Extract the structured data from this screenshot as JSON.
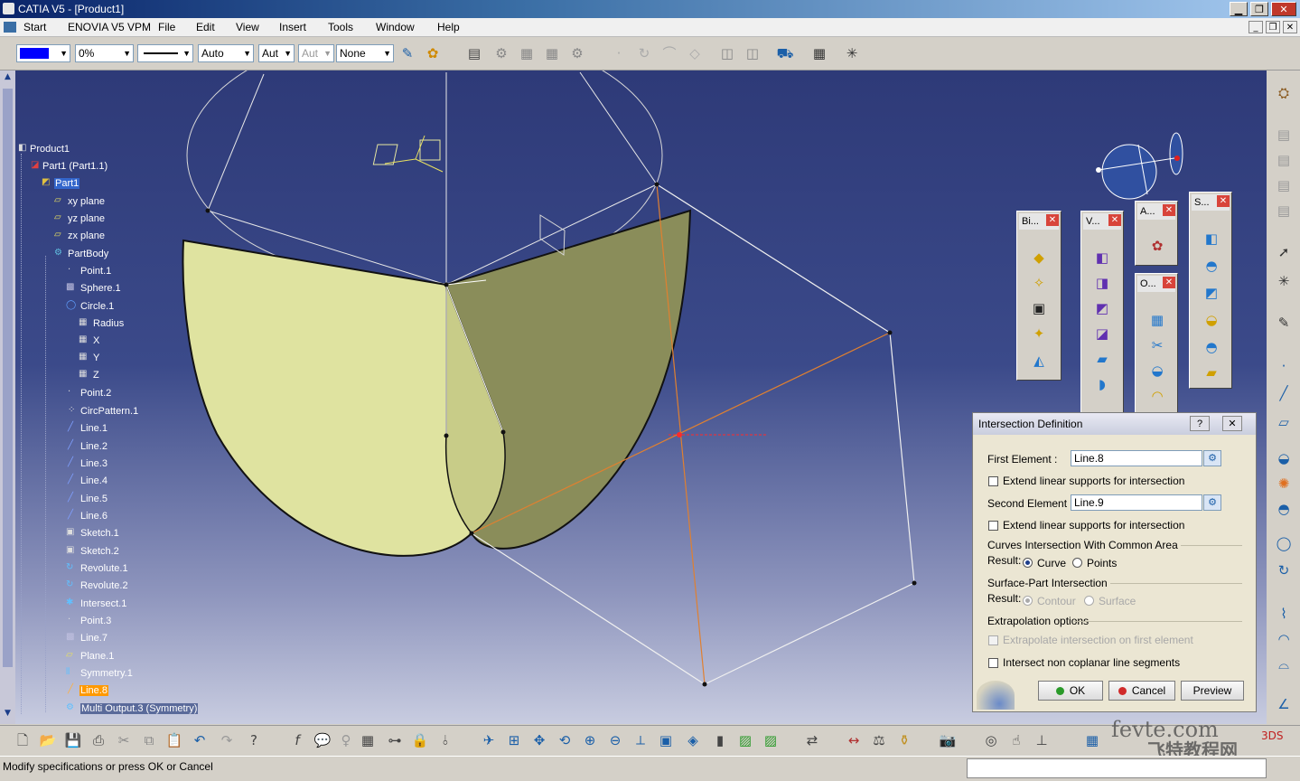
{
  "window": {
    "title": "CATIA V5 - [Product1]"
  },
  "menu": {
    "items": [
      "Start",
      "ENOVIA V5 VPM",
      "File",
      "Edit",
      "View",
      "Insert",
      "Tools",
      "Window",
      "Help"
    ]
  },
  "toolbar": {
    "color_hex": "#0000ff",
    "transparency": "0%",
    "linetype": "",
    "thickness": "Auto",
    "point_type": "Aut",
    "layer": "Aut",
    "render_style": "None"
  },
  "tree": {
    "nodes": [
      "Product1",
      "Part1 (Part1.1)",
      "Part1",
      "xy plane",
      "yz plane",
      "zx plane",
      "PartBody",
      "Point.1",
      "Sphere.1",
      "Circle.1",
      "Radius",
      "X",
      "Y",
      "Z",
      "Point.2",
      "CircPattern.1",
      "Line.1",
      "Line.2",
      "Line.3",
      "Line.4",
      "Line.5",
      "Line.6",
      "Sketch.1",
      "Sketch.2",
      "Revolute.1",
      "Revolute.2",
      "Intersect.1",
      "Point.3",
      "Line.7",
      "Plane.1",
      "Symmetry.1",
      "Line.8",
      "Multi Output.3 (Symmetry)"
    ]
  },
  "palettes": {
    "p1": "Bi...",
    "p2": "V...",
    "p3": "A...",
    "p4": "O...",
    "p5": "S..."
  },
  "dialog": {
    "title": "Intersection Definition",
    "help": "?",
    "first_label": "First Element :",
    "first_value": "Line.8",
    "extend1": "Extend linear supports for intersection",
    "second_label": "Second Element :",
    "second_value": "Line.9",
    "extend2": "Extend linear supports for intersection",
    "group1": "Curves Intersection With Common Area",
    "result1_label": "Result:",
    "curve": "Curve",
    "points": "Points",
    "group2": "Surface-Part Intersection",
    "result2_label": "Result:",
    "contour": "Contour",
    "surface": "Surface",
    "group3": "Extrapolation options",
    "extrapolate": "Extrapolate intersection on first element",
    "noncoplanar": "Intersect non coplanar line segments",
    "ok": "OK",
    "cancel": "Cancel",
    "preview": "Preview"
  },
  "status": {
    "message": "Modify specifications or press OK or Cancel"
  },
  "watermark": {
    "text": "fevte.com",
    "subtext": "飞特教程网"
  }
}
